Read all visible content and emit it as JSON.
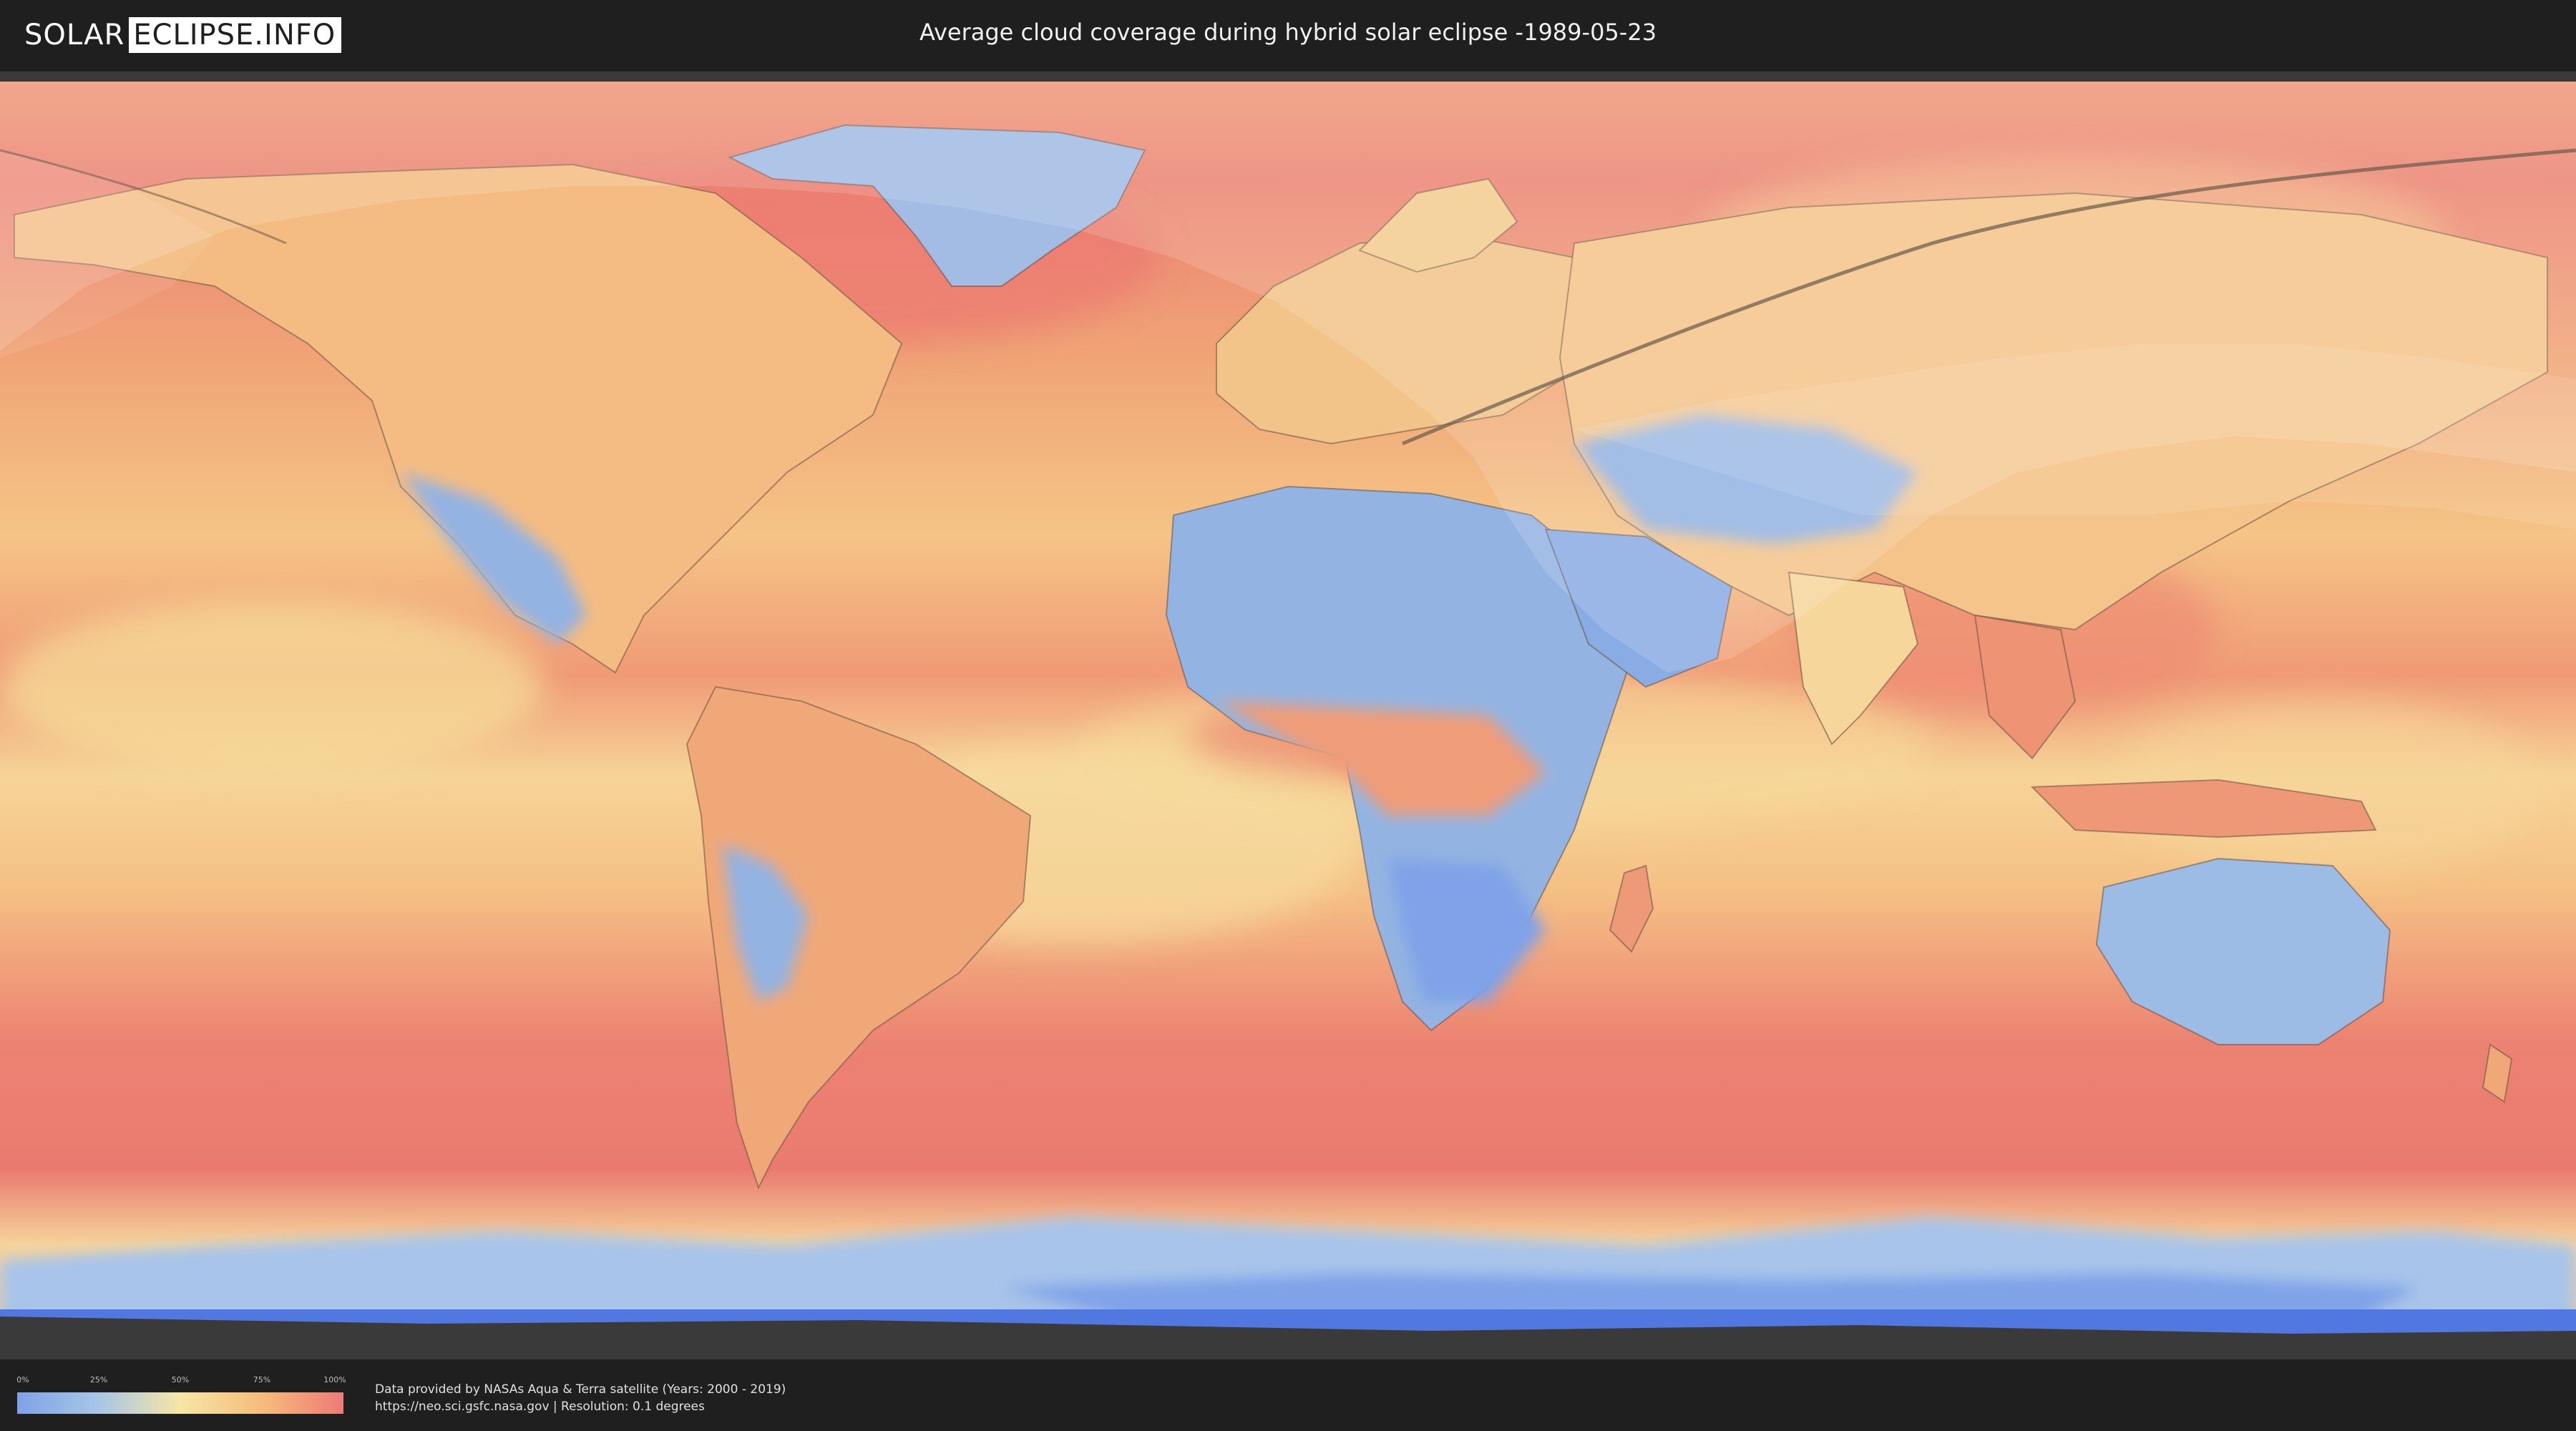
{
  "header": {
    "logo_left": "SOLAR",
    "logo_right": "ECLIPSE.INFO",
    "title": "Average cloud coverage during hybrid solar eclipse -1989-05-23"
  },
  "legend": {
    "ticks": [
      "0%",
      "25%",
      "50%",
      "75%",
      "100%"
    ],
    "tick_values": [
      0,
      25,
      50,
      75,
      100
    ],
    "colors": [
      "#7fa2e8",
      "#a8c6e6",
      "#f6e6a6",
      "#f6bc7a",
      "#ee7a78"
    ]
  },
  "footer": {
    "credit_line1": "Data provided by NASAs Aqua & Terra satellite (Years: 2000 - 2019)",
    "credit_line2": "https://neo.sci.gsfc.nasa.gov | Resolution: 0.1 degrees"
  },
  "map": {
    "colors": {
      "ocean_cloudy": "#ec8a72",
      "mid": "#f4bf80",
      "light": "#f6dc9a",
      "clear": "#8fb0e2",
      "antarctica": "#5078e0",
      "border": "#5a4a3a"
    }
  }
}
